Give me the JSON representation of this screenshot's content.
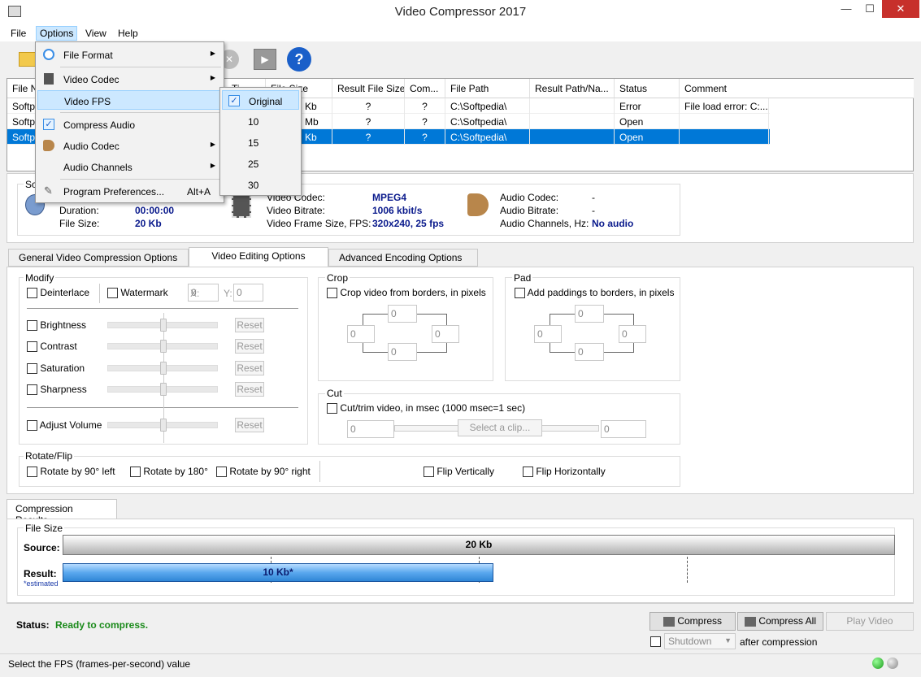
{
  "window": {
    "title": "Video Compressor 2017",
    "minimize": "—",
    "maximize": "☐",
    "close": "✕"
  },
  "menu": {
    "file": "File",
    "options": "Options",
    "view": "View",
    "help": "Help"
  },
  "grid": {
    "headers": [
      "File N",
      "Ti",
      "File Size",
      "Result File Size",
      "Com...",
      "File Path",
      "Result Path/Na...",
      "Status",
      "Comment"
    ],
    "rows": [
      {
        "name": "Softp",
        "size": "Kb",
        "result": "?",
        "comp": "?",
        "path": "C:\\Softpedia\\",
        "rpath": "",
        "status": "Error",
        "comment": "File load error: C:..."
      },
      {
        "name": "Softp",
        "size": "Mb",
        "result": "?",
        "comp": "?",
        "path": "C:\\Softpedia\\",
        "rpath": "",
        "status": "Open",
        "comment": ""
      },
      {
        "name": "Softp",
        "size": "Kb",
        "result": "?",
        "comp": "?",
        "path": "C:\\Softpedia\\",
        "rpath": "",
        "status": "Open",
        "comment": ""
      }
    ]
  },
  "options_menu": {
    "file_format": "File Format",
    "video_codec": "Video Codec",
    "video_fps": "Video FPS",
    "compress_audio": "Compress Audio",
    "audio_codec": "Audio Codec",
    "audio_channels": "Audio Channels",
    "program_prefs": "Program Preferences...",
    "program_prefs_shortcut": "Alt+A"
  },
  "fps_menu": {
    "original": "Original",
    "f10": "10",
    "f15": "15",
    "f25": "25",
    "f30": "30"
  },
  "source": {
    "label": "So",
    "duration_label": "Duration:",
    "duration": "00:00:00",
    "size_label": "File Size:",
    "size": "20 Kb",
    "vcodec_label": "Video Codec:",
    "vcodec": "MPEG4",
    "vbitrate_label": "Video Bitrate:",
    "vbitrate": "1006 kbit/s",
    "vframe_label": "Video Frame Size, FPS:",
    "vframe": "320x240, 25 fps",
    "acodec_label": "Audio Codec:",
    "acodec": "-",
    "abitrate_label": "Audio Bitrate:",
    "abitrate": "-",
    "achannels_label": "Audio Channels, Hz:",
    "achannels": "No audio"
  },
  "tabs": {
    "general": "General Video Compression Options",
    "editing": "Video Editing Options",
    "advanced": "Advanced Encoding Options"
  },
  "modify": {
    "title": "Modify",
    "deinterlace": "Deinterlace",
    "watermark": "Watermark",
    "x": "X:",
    "y": "Y:",
    "xval": "0",
    "yval": "0",
    "brightness": "Brightness",
    "contrast": "Contrast",
    "saturation": "Saturation",
    "sharpness": "Sharpness",
    "volume": "Adjust Volume",
    "reset": "Reset"
  },
  "crop": {
    "title": "Crop",
    "label": "Crop video from borders, in pixels",
    "top": "0",
    "left": "0",
    "right": "0",
    "bottom": "0"
  },
  "pad": {
    "title": "Pad",
    "label": "Add paddings to borders, in pixels",
    "top": "0",
    "left": "0",
    "right": "0",
    "bottom": "0"
  },
  "cut": {
    "title": "Cut",
    "label": "Cut/trim video, in msec (1000 msec=1 sec)",
    "start": "0",
    "select": "Select a clip...",
    "end": "0"
  },
  "rotate": {
    "title": "Rotate/Flip",
    "r90l": "Rotate by 90° left",
    "r180": "Rotate by 180°",
    "r90r": "Rotate by 90° right",
    "fv": "Flip Vertically",
    "fh": "Flip Horizontally"
  },
  "results": {
    "tab": "Compression Results",
    "file_size": "File Size",
    "source_label": "Source:",
    "source_val": "20 Kb",
    "result_label": "Result:",
    "estimated": "*estimated",
    "result_val": "10 Kb*",
    "result_fraction": 0.5
  },
  "status": {
    "label": "Status:",
    "text": "Ready to compress."
  },
  "actions": {
    "compress": "Compress",
    "compress_all": "Compress All",
    "play": "Play Video",
    "shutdown": "Shutdown",
    "after": "after compression"
  },
  "statusbar": {
    "text": "Select the FPS (frames-per-second) value"
  },
  "colors": {
    "accent": "#0078d7",
    "value_blue": "#0a1a8c",
    "status_green": "#1a8a1a",
    "close_red": "#c7302b"
  }
}
